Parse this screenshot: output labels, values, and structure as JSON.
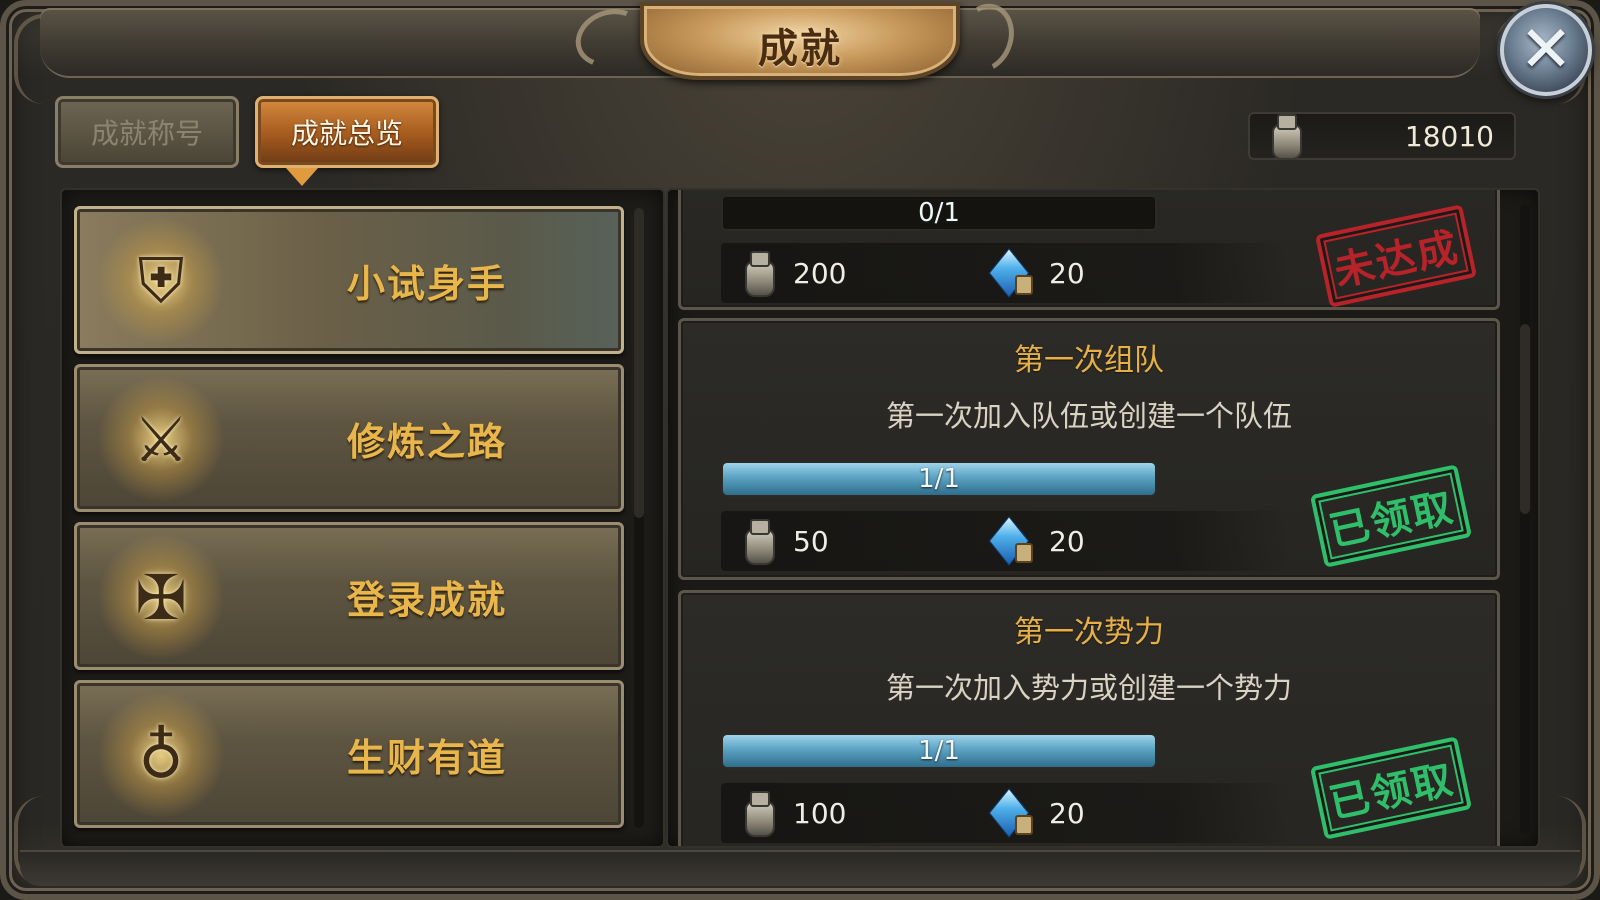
{
  "window": {
    "title": "成就",
    "close_icon": "close-icon"
  },
  "tabs": [
    {
      "label": "成就称号",
      "active": false
    },
    {
      "label": "成就总览",
      "active": true
    }
  ],
  "currency": {
    "icon": "jar-icon",
    "value": "18010"
  },
  "categories": [
    {
      "label": "小试身手",
      "icon": "winged-shield-icon",
      "selected": true
    },
    {
      "label": "修炼之路",
      "icon": "crossed-swords-icon",
      "selected": false
    },
    {
      "label": "登录成就",
      "icon": "medal-icon",
      "selected": false
    },
    {
      "label": "生财有道",
      "icon": "money-bag-icon",
      "selected": false
    }
  ],
  "achievements": [
    {
      "title": "",
      "description": "",
      "progress_text": "0/1",
      "progress": 0,
      "reward_jar": "200",
      "reward_gem": "20",
      "status": "未达成",
      "status_color": "#b8232a"
    },
    {
      "title": "第一次组队",
      "description": "第一次加入队伍或创建一个队伍",
      "progress_text": "1/1",
      "progress": 1,
      "reward_jar": "50",
      "reward_gem": "20",
      "status": "已领取",
      "status_color": "#2fbf6a"
    },
    {
      "title": "第一次势力",
      "description": "第一次加入势力或创建一个势力",
      "progress_text": "1/1",
      "progress": 1,
      "reward_jar": "100",
      "reward_gem": "20",
      "status": "已领取",
      "status_color": "#2fbf6a"
    }
  ],
  "colors": {
    "accent_gold": "#e9b64c",
    "progress_blue": "#5ca2c2",
    "claimed_green": "#2fbf6a",
    "not_reached_red": "#b8232a"
  }
}
